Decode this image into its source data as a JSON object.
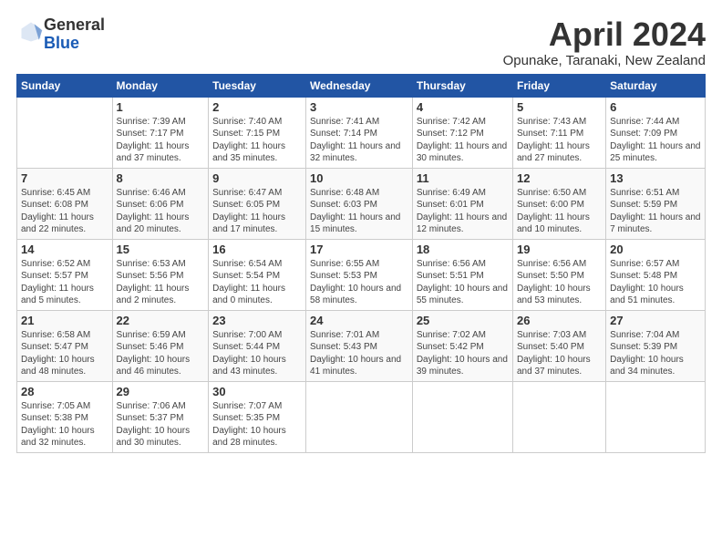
{
  "header": {
    "logo_general": "General",
    "logo_blue": "Blue",
    "main_title": "April 2024",
    "subtitle": "Opunake, Taranaki, New Zealand"
  },
  "columns": [
    "Sunday",
    "Monday",
    "Tuesday",
    "Wednesday",
    "Thursday",
    "Friday",
    "Saturday"
  ],
  "weeks": [
    [
      {
        "day": "",
        "sunrise": "",
        "sunset": "",
        "daylight": ""
      },
      {
        "day": "1",
        "sunrise": "Sunrise: 7:39 AM",
        "sunset": "Sunset: 7:17 PM",
        "daylight": "Daylight: 11 hours and 37 minutes."
      },
      {
        "day": "2",
        "sunrise": "Sunrise: 7:40 AM",
        "sunset": "Sunset: 7:15 PM",
        "daylight": "Daylight: 11 hours and 35 minutes."
      },
      {
        "day": "3",
        "sunrise": "Sunrise: 7:41 AM",
        "sunset": "Sunset: 7:14 PM",
        "daylight": "Daylight: 11 hours and 32 minutes."
      },
      {
        "day": "4",
        "sunrise": "Sunrise: 7:42 AM",
        "sunset": "Sunset: 7:12 PM",
        "daylight": "Daylight: 11 hours and 30 minutes."
      },
      {
        "day": "5",
        "sunrise": "Sunrise: 7:43 AM",
        "sunset": "Sunset: 7:11 PM",
        "daylight": "Daylight: 11 hours and 27 minutes."
      },
      {
        "day": "6",
        "sunrise": "Sunrise: 7:44 AM",
        "sunset": "Sunset: 7:09 PM",
        "daylight": "Daylight: 11 hours and 25 minutes."
      }
    ],
    [
      {
        "day": "7",
        "sunrise": "Sunrise: 6:45 AM",
        "sunset": "Sunset: 6:08 PM",
        "daylight": "Daylight: 11 hours and 22 minutes."
      },
      {
        "day": "8",
        "sunrise": "Sunrise: 6:46 AM",
        "sunset": "Sunset: 6:06 PM",
        "daylight": "Daylight: 11 hours and 20 minutes."
      },
      {
        "day": "9",
        "sunrise": "Sunrise: 6:47 AM",
        "sunset": "Sunset: 6:05 PM",
        "daylight": "Daylight: 11 hours and 17 minutes."
      },
      {
        "day": "10",
        "sunrise": "Sunrise: 6:48 AM",
        "sunset": "Sunset: 6:03 PM",
        "daylight": "Daylight: 11 hours and 15 minutes."
      },
      {
        "day": "11",
        "sunrise": "Sunrise: 6:49 AM",
        "sunset": "Sunset: 6:01 PM",
        "daylight": "Daylight: 11 hours and 12 minutes."
      },
      {
        "day": "12",
        "sunrise": "Sunrise: 6:50 AM",
        "sunset": "Sunset: 6:00 PM",
        "daylight": "Daylight: 11 hours and 10 minutes."
      },
      {
        "day": "13",
        "sunrise": "Sunrise: 6:51 AM",
        "sunset": "Sunset: 5:59 PM",
        "daylight": "Daylight: 11 hours and 7 minutes."
      }
    ],
    [
      {
        "day": "14",
        "sunrise": "Sunrise: 6:52 AM",
        "sunset": "Sunset: 5:57 PM",
        "daylight": "Daylight: 11 hours and 5 minutes."
      },
      {
        "day": "15",
        "sunrise": "Sunrise: 6:53 AM",
        "sunset": "Sunset: 5:56 PM",
        "daylight": "Daylight: 11 hours and 2 minutes."
      },
      {
        "day": "16",
        "sunrise": "Sunrise: 6:54 AM",
        "sunset": "Sunset: 5:54 PM",
        "daylight": "Daylight: 11 hours and 0 minutes."
      },
      {
        "day": "17",
        "sunrise": "Sunrise: 6:55 AM",
        "sunset": "Sunset: 5:53 PM",
        "daylight": "Daylight: 10 hours and 58 minutes."
      },
      {
        "day": "18",
        "sunrise": "Sunrise: 6:56 AM",
        "sunset": "Sunset: 5:51 PM",
        "daylight": "Daylight: 10 hours and 55 minutes."
      },
      {
        "day": "19",
        "sunrise": "Sunrise: 6:56 AM",
        "sunset": "Sunset: 5:50 PM",
        "daylight": "Daylight: 10 hours and 53 minutes."
      },
      {
        "day": "20",
        "sunrise": "Sunrise: 6:57 AM",
        "sunset": "Sunset: 5:48 PM",
        "daylight": "Daylight: 10 hours and 51 minutes."
      }
    ],
    [
      {
        "day": "21",
        "sunrise": "Sunrise: 6:58 AM",
        "sunset": "Sunset: 5:47 PM",
        "daylight": "Daylight: 10 hours and 48 minutes."
      },
      {
        "day": "22",
        "sunrise": "Sunrise: 6:59 AM",
        "sunset": "Sunset: 5:46 PM",
        "daylight": "Daylight: 10 hours and 46 minutes."
      },
      {
        "day": "23",
        "sunrise": "Sunrise: 7:00 AM",
        "sunset": "Sunset: 5:44 PM",
        "daylight": "Daylight: 10 hours and 43 minutes."
      },
      {
        "day": "24",
        "sunrise": "Sunrise: 7:01 AM",
        "sunset": "Sunset: 5:43 PM",
        "daylight": "Daylight: 10 hours and 41 minutes."
      },
      {
        "day": "25",
        "sunrise": "Sunrise: 7:02 AM",
        "sunset": "Sunset: 5:42 PM",
        "daylight": "Daylight: 10 hours and 39 minutes."
      },
      {
        "day": "26",
        "sunrise": "Sunrise: 7:03 AM",
        "sunset": "Sunset: 5:40 PM",
        "daylight": "Daylight: 10 hours and 37 minutes."
      },
      {
        "day": "27",
        "sunrise": "Sunrise: 7:04 AM",
        "sunset": "Sunset: 5:39 PM",
        "daylight": "Daylight: 10 hours and 34 minutes."
      }
    ],
    [
      {
        "day": "28",
        "sunrise": "Sunrise: 7:05 AM",
        "sunset": "Sunset: 5:38 PM",
        "daylight": "Daylight: 10 hours and 32 minutes."
      },
      {
        "day": "29",
        "sunrise": "Sunrise: 7:06 AM",
        "sunset": "Sunset: 5:37 PM",
        "daylight": "Daylight: 10 hours and 30 minutes."
      },
      {
        "day": "30",
        "sunrise": "Sunrise: 7:07 AM",
        "sunset": "Sunset: 5:35 PM",
        "daylight": "Daylight: 10 hours and 28 minutes."
      },
      {
        "day": "",
        "sunrise": "",
        "sunset": "",
        "daylight": ""
      },
      {
        "day": "",
        "sunrise": "",
        "sunset": "",
        "daylight": ""
      },
      {
        "day": "",
        "sunrise": "",
        "sunset": "",
        "daylight": ""
      },
      {
        "day": "",
        "sunrise": "",
        "sunset": "",
        "daylight": ""
      }
    ]
  ]
}
